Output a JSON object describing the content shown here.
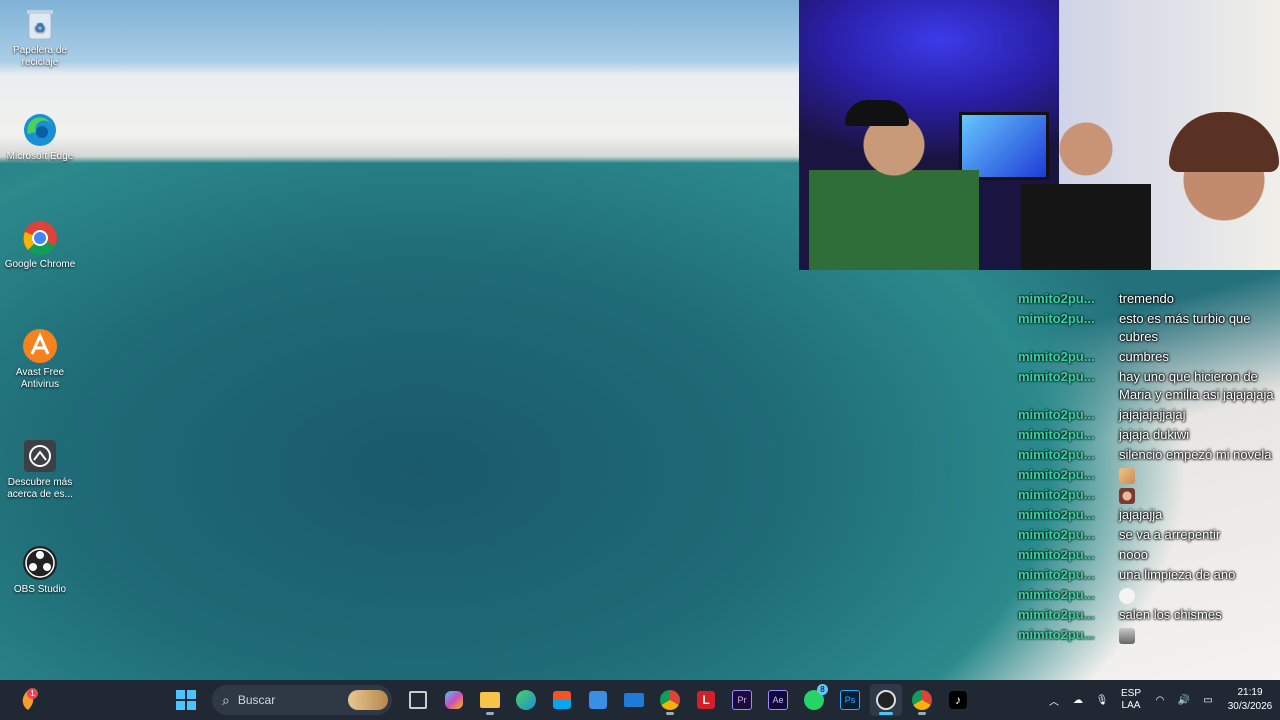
{
  "desktop": {
    "icons": [
      {
        "label": "Papelera de reciclaje",
        "icon": "recycle-bin-icon"
      },
      {
        "label": "Microsoft Edge",
        "icon": "edge-icon"
      },
      {
        "label": "Google Chrome",
        "icon": "chrome-icon"
      },
      {
        "label": "Avast Free Antivirus",
        "icon": "avast-icon"
      },
      {
        "label": "Descubre más acerca de es...",
        "icon": "discover-icon"
      },
      {
        "label": "OBS Studio",
        "icon": "obs-icon"
      }
    ]
  },
  "chat": {
    "messages": [
      {
        "user": "mimito2pu...",
        "text": "tremendo"
      },
      {
        "user": "mimito2pu...",
        "text": "esto es más turbio que cubres"
      },
      {
        "user": "mimito2pu...",
        "text": "cumbres"
      },
      {
        "user": "mimito2pu...",
        "text": "hay uno que hicieron de Maria y emilia asi jajajajaja"
      },
      {
        "user": "mimito2pu...",
        "text": "jajajajajjajaj"
      },
      {
        "user": "mimito2pu...",
        "text": "jajaja dukiwi"
      },
      {
        "user": "mimito2pu...",
        "text": "silencio empezó mi novela"
      },
      {
        "user": "mimito2pu...",
        "text": "",
        "emote": "hand-emote"
      },
      {
        "user": "mimito2pu...",
        "text": "",
        "emote": "face-emote"
      },
      {
        "user": "mimito2pu...",
        "text": "jajajajja"
      },
      {
        "user": "mimito2pu...",
        "text": "se va a arrepentir"
      },
      {
        "user": "mimito2pu...",
        "text": "nooo"
      },
      {
        "user": "mimito2pu...",
        "text": "una limpieza de ano"
      },
      {
        "user": "mimito2pu...",
        "text": "",
        "emote": "cloud-emote"
      },
      {
        "user": "mimito2pu...",
        "text": "salen los chismes"
      },
      {
        "user": "mimito2pu...",
        "text": "",
        "emote": "figure-emote"
      }
    ]
  },
  "taskbar": {
    "search_placeholder": "Buscar",
    "apps": [
      {
        "name": "task-view-icon"
      },
      {
        "name": "copilot-icon"
      },
      {
        "name": "file-explorer-icon"
      },
      {
        "name": "edge-icon"
      },
      {
        "name": "store-icon"
      },
      {
        "name": "vscode-icon"
      },
      {
        "name": "mail-icon"
      },
      {
        "name": "chrome-icon"
      },
      {
        "name": "l-app-icon"
      },
      {
        "name": "premiere-icon"
      },
      {
        "name": "after-effects-icon"
      },
      {
        "name": "whatsapp-icon"
      },
      {
        "name": "photoshop-icon"
      },
      {
        "name": "obs-icon"
      },
      {
        "name": "chrome-profile-icon"
      },
      {
        "name": "tiktok-icon"
      }
    ],
    "whatsapp_badge": "8",
    "widget_badge": "1",
    "tray": {
      "lang_top": "ESP",
      "lang_bottom": "LAA",
      "time": "21:19",
      "date": "30/3/2026"
    }
  },
  "colors": {
    "chat_user": "#39d3a0",
    "taskbar_bg": "#1f2833"
  }
}
